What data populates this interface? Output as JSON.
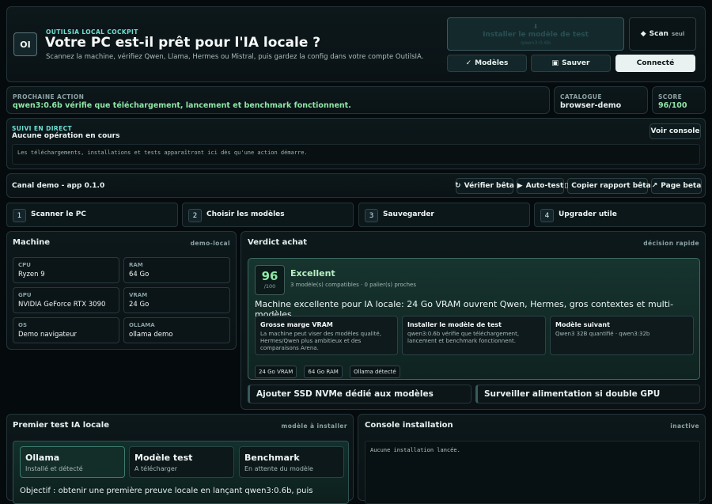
{
  "header": {
    "logo_initials": "OI",
    "kicker": "OUTILSIA LOCAL COCKPIT",
    "title": "Votre PC est-il prêt pour l'IA locale ?",
    "subtitle": "Scannez la machine, vérifiez Qwen, Llama, Hermes ou Mistral, puis gardez la config dans votre compte OutilsIA."
  },
  "actions": {
    "install_label": "Installer le modèle de test",
    "install_sub": "qwen3:0.6b",
    "scan_label": "Scan",
    "scan_sub": "seul",
    "models_label": "Modèles",
    "save_label": "Sauver",
    "connected_label": "Connecté"
  },
  "next_action": {
    "label": "PROCHAINE ACTION",
    "value": "qwen3:0.6b vérifie que téléchargement, lancement et benchmark fonctionnent."
  },
  "catalogue": {
    "label": "CATALOGUE",
    "value": "browser-demo"
  },
  "score": {
    "label": "SCORE",
    "value": "96/100"
  },
  "live": {
    "label": "SUIVI EN DIRECT",
    "title": "Aucune opération en cours",
    "log": "Les téléchargements, installations et tests apparaîtront ici dès qu'une action démarre.",
    "console_btn": "Voir console"
  },
  "channel": {
    "label": "Canal demo - app 0.1.0",
    "verify": "Vérifier bêta",
    "autotest": "Auto-test",
    "copy": "Copier rapport bêta",
    "page": "Page beta"
  },
  "steps": [
    {
      "num": "1",
      "label": "Scanner le PC"
    },
    {
      "num": "2",
      "label": "Choisir les modèles"
    },
    {
      "num": "3",
      "label": "Sauvegarder"
    },
    {
      "num": "4",
      "label": "Upgrader utile"
    }
  ],
  "machine": {
    "title": "Machine",
    "tag": "demo-local",
    "specs": [
      {
        "label": "CPU",
        "value": "Ryzen 9"
      },
      {
        "label": "RAM",
        "value": "64 Go"
      },
      {
        "label": "GPU",
        "value": "NVIDIA GeForce RTX 3090"
      },
      {
        "label": "VRAM",
        "value": "24 Go"
      },
      {
        "label": "OS",
        "value": "Demo navigateur"
      },
      {
        "label": "OLLAMA",
        "value": "ollama demo"
      }
    ]
  },
  "verdict": {
    "title": "Verdict achat",
    "tag": "décision rapide",
    "score": "96",
    "score_max": "/100",
    "rating": "Excellent",
    "compat": "3 modèle(s) compatibles · 0 palier(s) proches",
    "summary": "Machine excellente pour IA locale: 24 Go VRAM ouvrent Qwen, Hermes, gros contextes et multi-modèles.",
    "cards": [
      {
        "title": "Grosse marge VRAM",
        "desc": "La machine peut viser des modèles qualité, Hermes/Qwen plus ambitieux et des comparaisons Arena."
      },
      {
        "title": "Installer le modèle de test",
        "desc": "qwen3:0.6b vérifie que téléchargement, lancement et benchmark fonctionnent."
      },
      {
        "title": "Modèle suivant",
        "desc": "Qwen3 32B quantifié · qwen3:32b"
      }
    ],
    "chips": [
      "24 Go VRAM",
      "64 Go RAM",
      "Ollama détecté"
    ],
    "upgrades": [
      "Ajouter SSD NVMe dédié aux modèles",
      "Surveiller alimentation si double GPU"
    ]
  },
  "first_test": {
    "title": "Premier test IA locale",
    "tag": "modèle à installer",
    "cards": [
      {
        "title": "Ollama",
        "status": "Installé et détecté"
      },
      {
        "title": "Modèle test",
        "status": "A télécharger"
      },
      {
        "title": "Benchmark",
        "status": "En attente du modèle"
      }
    ],
    "objective": "Objectif : obtenir une première preuve locale en lançant qwen3:0.6b, puis"
  },
  "console": {
    "title": "Console installation",
    "tag": "inactive",
    "log": "Aucune installation lancée."
  },
  "colors": {
    "accent": "#6fe0d3",
    "green": "#8ee6a6",
    "background": "#050b0d"
  }
}
